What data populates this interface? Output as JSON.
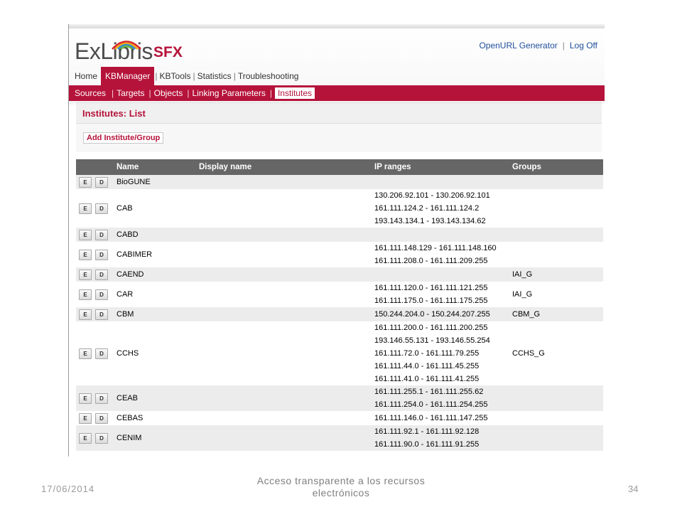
{
  "brand": {
    "logo_text": "ExLibris",
    "product": "SFX",
    "accent": "#b5133a"
  },
  "top_links": [
    "OpenURL Generator",
    "Log Off"
  ],
  "main_nav": [
    {
      "label": "Home",
      "active": false
    },
    {
      "label": "KBManager",
      "active": true
    },
    {
      "label": "KBTools",
      "active": false
    },
    {
      "label": "Statistics",
      "active": false
    },
    {
      "label": "Troubleshooting",
      "active": false
    }
  ],
  "sub_nav": [
    {
      "label": "Sources",
      "active": false
    },
    {
      "label": "Targets",
      "active": false
    },
    {
      "label": "Objects",
      "active": false
    },
    {
      "label": "Linking Parameters",
      "active": false
    },
    {
      "label": "Institutes",
      "active": true
    }
  ],
  "page_title": "Institutes: List",
  "add_button": "Add Institute/Group",
  "table": {
    "headers": [
      "Name",
      "Display name",
      "IP ranges",
      "Groups"
    ],
    "edit_label": "E",
    "delete_label": "D",
    "rows": [
      {
        "name": "BioGUNE",
        "display": "",
        "ips": [],
        "group": ""
      },
      {
        "name": "CAB",
        "display": "",
        "ips": [
          "130.206.92.101 - 130.206.92.101",
          "161.111.124.2 - 161.111.124.2",
          "193.143.134.1 - 193.143.134.62"
        ],
        "group": ""
      },
      {
        "name": "CABD",
        "display": "",
        "ips": [],
        "group": ""
      },
      {
        "name": "CABIMER",
        "display": "",
        "ips": [
          "161.111.148.129 - 161.111.148.160",
          "161.111.208.0 - 161.111.209.255"
        ],
        "group": ""
      },
      {
        "name": "CAEND",
        "display": "",
        "ips": [],
        "group": "IAI_G"
      },
      {
        "name": "CAR",
        "display": "",
        "ips": [
          "161.111.120.0 - 161.111.121.255",
          "161.111.175.0 - 161.111.175.255"
        ],
        "group": "IAI_G"
      },
      {
        "name": "CBM",
        "display": "",
        "ips": [
          "150.244.204.0 - 150.244.207.255"
        ],
        "group": "CBM_G"
      },
      {
        "name": "CCHS",
        "display": "",
        "ips": [
          "161.111.200.0 - 161.111.200.255",
          "193.146.55.131 - 193.146.55.254",
          "161.111.72.0 - 161.111.79.255",
          "161.111.44.0 - 161.111.45.255",
          "161.111.41.0 - 161.111.41.255"
        ],
        "group": "CCHS_G"
      },
      {
        "name": "CEAB",
        "display": "",
        "ips": [
          "161.111.255.1 - 161.111.255.62",
          "161.111.254.0 - 161.111.254.255"
        ],
        "group": ""
      },
      {
        "name": "CEBAS",
        "display": "",
        "ips": [
          "161.111.146.0 - 161.111.147.255"
        ],
        "group": ""
      },
      {
        "name": "CENIM",
        "display": "",
        "ips": [
          "161.111.92.1 - 161.111.92.128",
          "161.111.90.0 - 161.111.91.255"
        ],
        "group": ""
      }
    ]
  },
  "footer": {
    "date": "17/06/2014",
    "title": "Acceso transparente a los recursos electrónicos",
    "page": "34"
  }
}
